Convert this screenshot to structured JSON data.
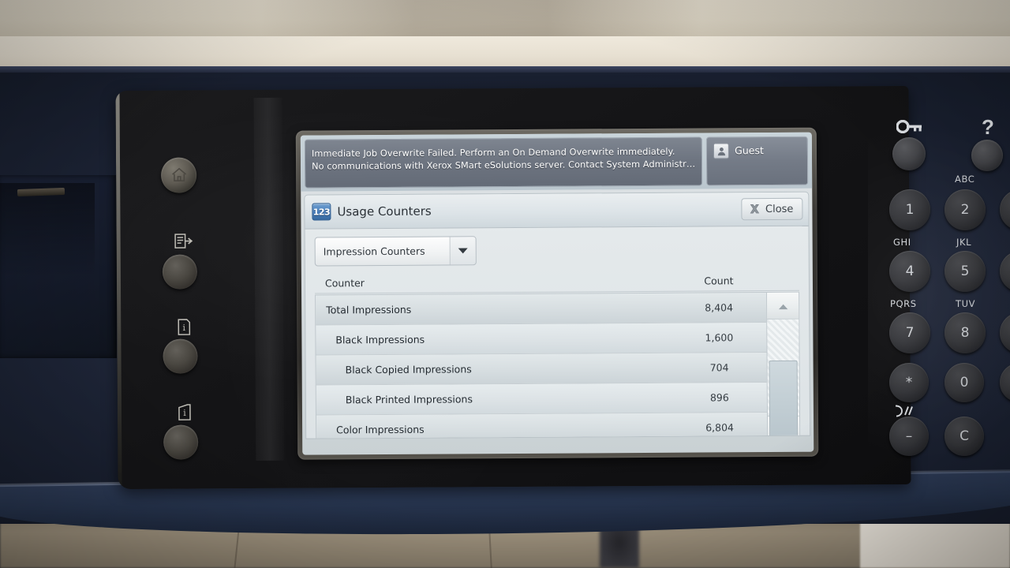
{
  "device": {
    "brand_color": "#1d2436",
    "panel_color": "#141416"
  },
  "status_bar": {
    "message_lines": [
      "Immediate Job Overwrite Failed.  Perform an On Demand Overwrite immediately.",
      "No communications with Xerox SMart eSolutions server. Contact System Administr…"
    ],
    "user_button": {
      "label": "Guest",
      "icon": "user-icon"
    }
  },
  "dialog": {
    "icon": "usage-counter-icon",
    "icon_text": "123",
    "title": "Usage Counters",
    "close": {
      "label": "Close",
      "icon": "close-x-icon"
    },
    "dropdown": {
      "selected": "Impression Counters",
      "icon": "chevron-down-icon"
    },
    "table": {
      "headers": {
        "counter": "Counter",
        "count": "Count"
      },
      "rows": [
        {
          "name": "Total Impressions",
          "count": "8,404",
          "indent": 0
        },
        {
          "name": "Black Impressions",
          "count": "1,600",
          "indent": 1
        },
        {
          "name": "Black Copied Impressions",
          "count": "704",
          "indent": 2
        },
        {
          "name": "Black Printed Impressions",
          "count": "896",
          "indent": 2
        },
        {
          "name": "Color Impressions",
          "count": "6,804",
          "indent": 1
        }
      ]
    },
    "scrollbar": {
      "up_icon": "triangle-up-icon",
      "down_icon": "triangle-down-icon"
    }
  },
  "left_buttons": [
    {
      "name": "services-home-button",
      "icon": "home-icon"
    },
    {
      "name": "job-status-button",
      "icon": "job-status-icon"
    },
    {
      "name": "machine-status-button",
      "icon": "machine-status-icon"
    },
    {
      "name": "information-button",
      "icon": "information-icon"
    }
  ],
  "keypad": {
    "top_buttons": [
      {
        "name": "log-in-out-button",
        "icon": "key-icon",
        "glyph": ""
      },
      {
        "name": "help-button",
        "icon": "question-icon",
        "glyph": "?"
      }
    ],
    "keys": [
      {
        "digit": "1",
        "letters": ""
      },
      {
        "digit": "2",
        "letters": "ABC"
      },
      {
        "digit": "4",
        "letters": "GHI"
      },
      {
        "digit": "5",
        "letters": "JKL"
      },
      {
        "digit": "7",
        "letters": "PQRS"
      },
      {
        "digit": "8",
        "letters": "TUV"
      },
      {
        "digit": "*",
        "letters": ""
      },
      {
        "digit": "0",
        "letters": ""
      },
      {
        "digit": "–",
        "letters": ""
      },
      {
        "digit": "C",
        "letters": ""
      }
    ],
    "dial_pause_icon": "dial-pause-icon"
  }
}
